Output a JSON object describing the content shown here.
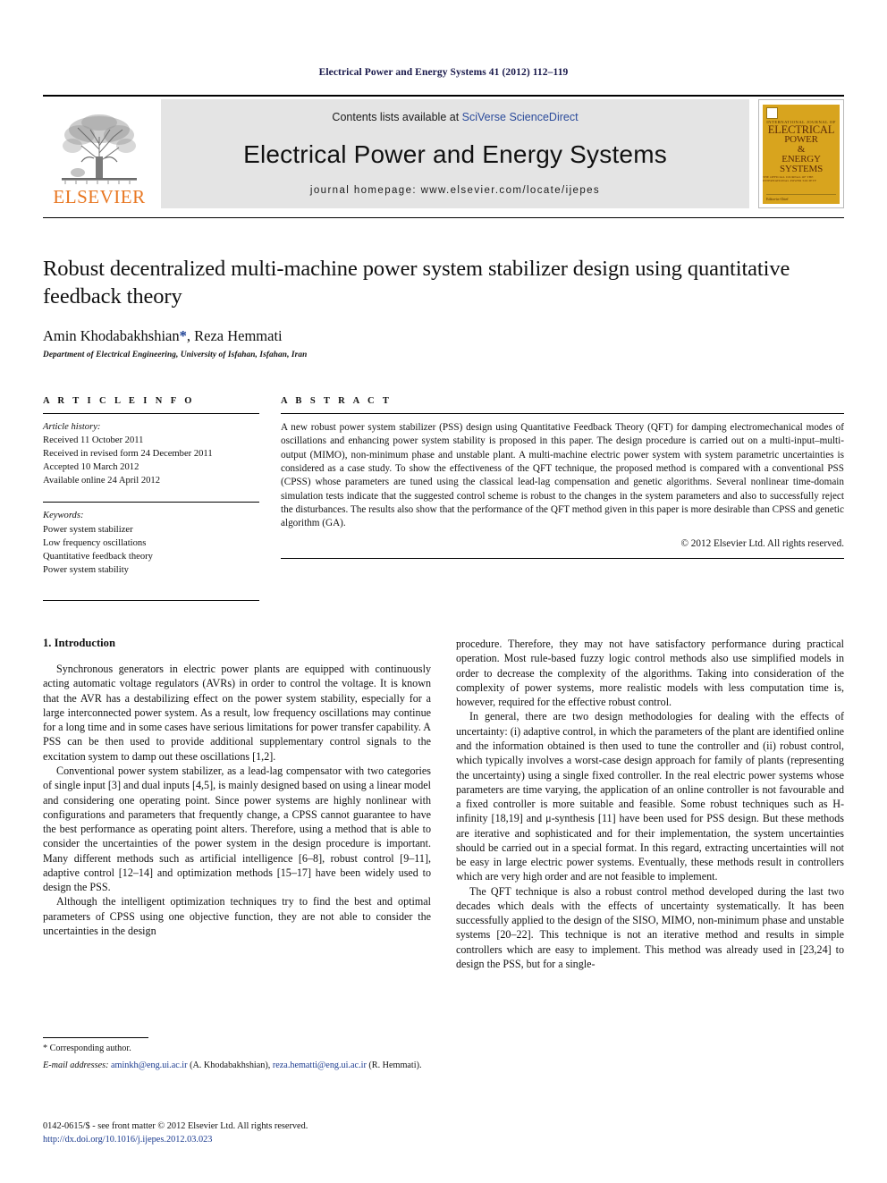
{
  "running_head": "Electrical Power and Energy Systems 41 (2012) 112–119",
  "masthead": {
    "publisher_name": "ELSEVIER",
    "contents_prefix": "Contents lists available at ",
    "contents_link": "SciVerse ScienceDirect",
    "journal_title": "Electrical Power and Energy Systems",
    "homepage": "journal homepage: www.elsevier.com/locate/ijepes",
    "cover": {
      "topline": "INTERNATIONAL JOURNAL OF",
      "line1": "ELECTRICAL",
      "line2": "POWER",
      "line3": "&",
      "line4": "ENERGY",
      "line5": "SYSTEMS",
      "subline": "THE OFFICIAL JOURNAL OF THE INTERNATIONAL POWER SOCIETY",
      "footer": "Editor-in-Chief"
    }
  },
  "article": {
    "title": "Robust decentralized multi-machine power system stabilizer design using quantitative feedback theory",
    "authors": "Amin Khodabakhshian",
    "authors_star": "*",
    "authors_rest": ", Reza Hemmati",
    "affiliation": "Department of Electrical Engineering, University of Isfahan, Isfahan, Iran"
  },
  "article_info": {
    "heading": "A R T I C L E    I N F O",
    "history_label": "Article history:",
    "history": [
      "Received 11 October 2011",
      "Received in revised form 24 December 2011",
      "Accepted 10 March 2012",
      "Available online 24 April 2012"
    ],
    "keywords_label": "Keywords:",
    "keywords": [
      "Power system stabilizer",
      "Low frequency oscillations",
      "Quantitative feedback theory",
      "Power system stability"
    ]
  },
  "abstract": {
    "heading": "A B S T R A C T",
    "text": "A new robust power system stabilizer (PSS) design using Quantitative Feedback Theory (QFT) for damping electromechanical modes of oscillations and enhancing power system stability is proposed in this paper. The design procedure is carried out on a multi-input–multi-output (MIMO), non-minimum phase and unstable plant. A multi-machine electric power system with system parametric uncertainties is considered as a case study. To show the effectiveness of the QFT technique, the proposed method is compared with a conventional PSS (CPSS) whose parameters are tuned using the classical lead-lag compensation and genetic algorithms. Several nonlinear time-domain simulation tests indicate that the suggested control scheme is robust to the changes in the system parameters and also to successfully reject the disturbances. The results also show that the performance of the QFT method given in this paper is more desirable than CPSS and genetic algorithm (GA).",
    "copyright": "© 2012 Elsevier Ltd. All rights reserved."
  },
  "body": {
    "section_title": "1. Introduction",
    "left_paragraphs": [
      "Synchronous generators in electric power plants are equipped with continuously acting automatic voltage regulators (AVRs) in order to control the voltage. It is known that the AVR has a destabilizing effect on the power system stability, especially for a large interconnected power system. As a result, low frequency oscillations may continue for a long time and in some cases have serious limitations for power transfer capability. A PSS can be then used to provide additional supplementary control signals to the excitation system to damp out these oscillations [1,2].",
      "Conventional power system stabilizer, as a lead-lag compensator with two categories of single input [3] and dual inputs [4,5], is mainly designed based on using a linear model and considering one operating point. Since power systems are highly nonlinear with configurations and parameters that frequently change, a CPSS cannot guarantee to have the best performance as operating point alters. Therefore, using a method that is able to consider the uncertainties of the power system in the design procedure is important. Many different methods such as artificial intelligence [6–8], robust control [9–11], adaptive control [12–14] and optimization methods [15–17] have been widely used to design the PSS.",
      "Although the intelligent optimization techniques try to find the best and optimal parameters of CPSS using one objective function, they are not able to consider the uncertainties in the design"
    ],
    "right_paragraphs": [
      "procedure. Therefore, they may not have satisfactory performance during practical operation. Most rule-based fuzzy logic control methods also use simplified models in order to decrease the complexity of the algorithms. Taking into consideration of the complexity of power systems, more realistic models with less computation time is, however, required for the effective robust control.",
      "In general, there are two design methodologies for dealing with the effects of uncertainty: (i) adaptive control, in which the parameters of the plant are identified online and the information obtained is then used to tune the controller and (ii) robust control, which typically involves a worst-case design approach for family of plants (representing the uncertainty) using a single fixed controller. In the real electric power systems whose parameters are time varying, the application of an online controller is not favourable and a fixed controller is more suitable and feasible. Some robust techniques such as H-infinity [18,19] and μ-synthesis [11] have been used for PSS design. But these methods are iterative and sophisticated and for their implementation, the system uncertainties should be carried out in a special format. In this regard, extracting uncertainties will not be easy in large electric power systems. Eventually, these methods result in controllers which are very high order and are not feasible to implement.",
      "The QFT technique is also a robust control method developed during the last two decades which deals with the effects of uncertainty systematically. It has been successfully applied to the design of the SISO, MIMO, non-minimum phase and unstable systems [20–22]. This technique is not an iterative method and results in simple controllers which are easy to implement. This method was already used in [23,24] to design the PSS, but for a single-"
    ]
  },
  "footnotes": {
    "corresponding": "* Corresponding author.",
    "email_label": "E-mail addresses:",
    "email1": "aminkh@eng.ui.ac.ir",
    "email1_owner": "(A. Khodabakhshian),",
    "email2": "reza.hematti@eng.ui.ac.ir",
    "email2_owner": "(R. Hemmati).",
    "front_matter": "0142-0615/$ - see front matter © 2012 Elsevier Ltd. All rights reserved.",
    "doi": "http://dx.doi.org/10.1016/j.ijepes.2012.03.023"
  },
  "colors": {
    "link_blue": "#1b3b8f",
    "elsevier_orange": "#e87722",
    "cover_gold": "#d8a41e",
    "band_gray": "#e4e4e4"
  }
}
